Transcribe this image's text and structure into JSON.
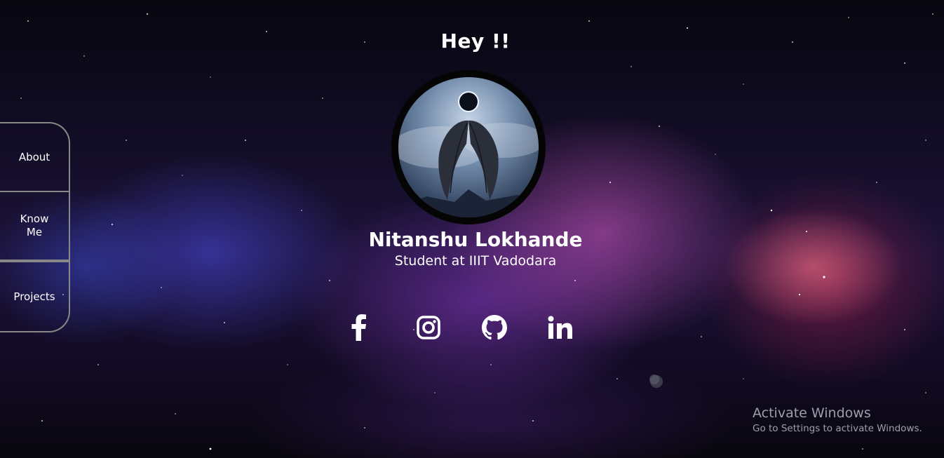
{
  "greeting": "Hey !!",
  "profile": {
    "name": "Nitanshu Lokhande",
    "subtitle": "Student at IIIT Vadodara",
    "avatar_icon": "dark-angel-wings-icon"
  },
  "sidebar": {
    "items": [
      {
        "label": "About"
      },
      {
        "label": "Know Me"
      },
      {
        "label": "Projects"
      }
    ]
  },
  "socials": [
    {
      "icon": "facebook-icon"
    },
    {
      "icon": "instagram-icon"
    },
    {
      "icon": "github-icon"
    },
    {
      "icon": "linkedin-icon"
    }
  ],
  "watermark": {
    "title": "Activate Windows",
    "subtitle": "Go to Settings to activate Windows."
  },
  "colors": {
    "text": "#ffffff",
    "sidebar_border": "#888888",
    "avatar_ring": "#050505"
  }
}
